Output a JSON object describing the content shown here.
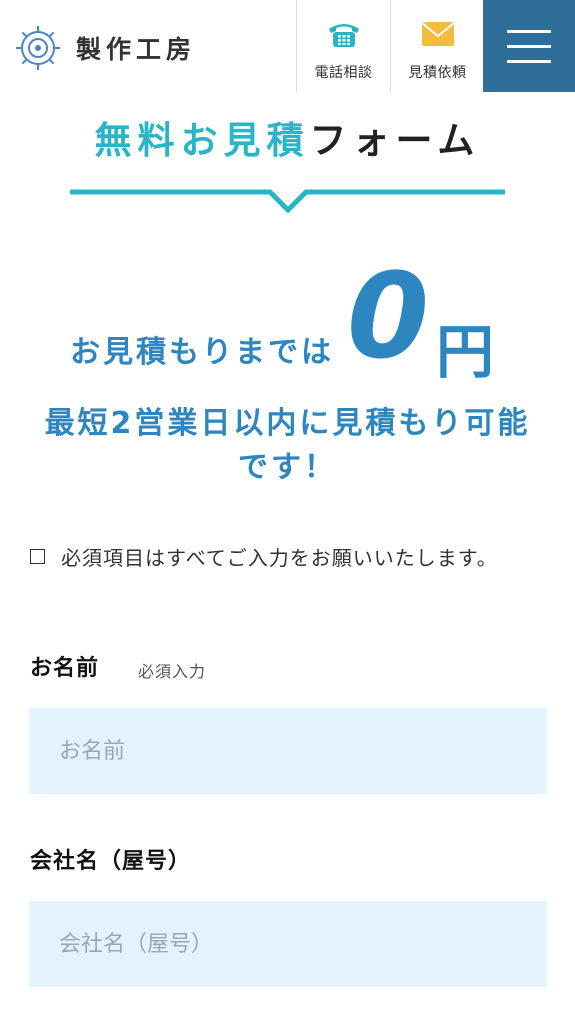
{
  "header": {
    "logo_text": "製作工房",
    "tel_label": "電話相談",
    "quote_label": "見積依頼",
    "colors": {
      "menu_bg": "#2f6e98",
      "accent": "#27b5c7",
      "blue": "#2e86c1"
    }
  },
  "title": {
    "accent_part": "無料お見積",
    "dark_part": "フォーム"
  },
  "promo": {
    "lead": "お見積もりまでは",
    "amount": "0",
    "unit": "円",
    "sub": "最短2営業日以内に見積もり可能です！"
  },
  "note": "必須項目はすべてご入力をお願いいたします。",
  "form": {
    "name": {
      "label": "お名前",
      "required": "必須入力",
      "placeholder": "お名前"
    },
    "company": {
      "label": "会社名（屋号）",
      "placeholder": "会社名（屋号）"
    }
  }
}
